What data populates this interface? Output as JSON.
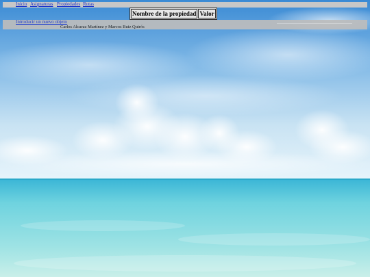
{
  "nav": {
    "items": [
      {
        "label": "Inicio"
      },
      {
        "label": "Asignaturas"
      },
      {
        "label": "Propiedades"
      },
      {
        "label": "Rutas"
      }
    ]
  },
  "properties_table": {
    "headers": [
      "Nombre de la propiedad",
      "Valor"
    ]
  },
  "actions": {
    "new_object_link": "Introducir un nuevo objeto"
  },
  "footer": {
    "authors": "Carlos Alcaraz Martínez y Marcos Ruiz Quirós"
  },
  "colors": {
    "nav_bar": "#c7c7c7",
    "link": "#1a33cc",
    "sky_top": "#3c8fd6",
    "sea": "#5fd0dc"
  }
}
